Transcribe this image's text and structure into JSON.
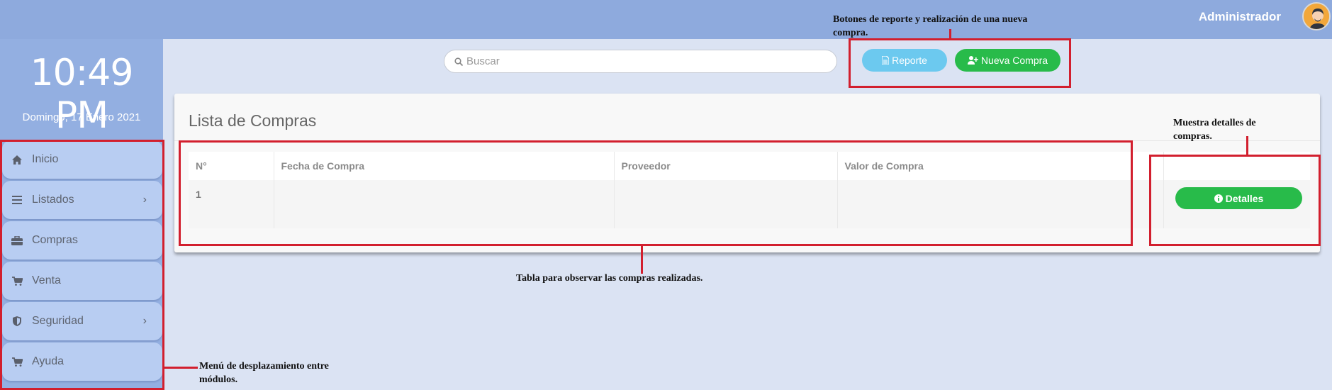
{
  "header": {
    "user_name": "Administrador",
    "avatar_icon": "user-avatar-icon",
    "background_color": "#8eaadd"
  },
  "sidebar": {
    "clock": "10:49 PM",
    "date": "Domingo, 17 Enero 2021",
    "items": [
      {
        "label": "Inicio",
        "icon": "home-icon",
        "has_submenu": false
      },
      {
        "label": "Listados",
        "icon": "list-icon",
        "has_submenu": true
      },
      {
        "label": "Compras",
        "icon": "briefcase-icon",
        "has_submenu": false
      },
      {
        "label": "Venta",
        "icon": "cart-icon",
        "has_submenu": false
      },
      {
        "label": "Seguridad",
        "icon": "shield-icon",
        "has_submenu": true
      },
      {
        "label": "Ayuda",
        "icon": "cart-icon",
        "has_submenu": false
      }
    ]
  },
  "search": {
    "placeholder": "Buscar",
    "value": ""
  },
  "toolbar": {
    "report_label": "Reporte",
    "new_purchase_label": "Nueva Compra"
  },
  "purchases": {
    "title": "Lista de Compras",
    "columns": [
      "N°",
      "Fecha de Compra",
      "Proveedor",
      "Valor de Compra",
      ""
    ],
    "rows": [
      {
        "number": "1",
        "date": "",
        "supplier": "",
        "value": ""
      }
    ],
    "details_label": "Detalles"
  },
  "annotations": {
    "buttons": "Botones de reporte y realización de una nueva compra.",
    "details": "Muestra detalles de compras.",
    "table": "Tabla para observar las compras realizadas.",
    "menu": "Menú de desplazamiento entre módulos."
  },
  "colors": {
    "accent_green": "#28bb4a",
    "accent_blue": "#6cc9ef",
    "annotation_red": "#d21f2e",
    "sidebar": "#93afe1",
    "menu_item": "#b8cdf2"
  }
}
